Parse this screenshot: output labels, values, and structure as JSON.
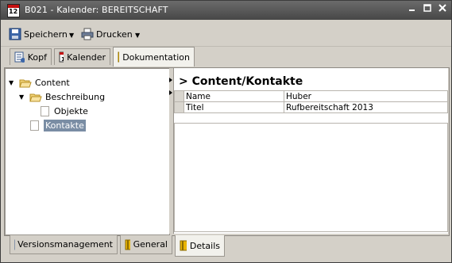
{
  "window": {
    "title": "B021 - Kalender: BEREITSCHAFT",
    "calendar_day": "12"
  },
  "toolbar": {
    "save_label": "Speichern",
    "print_label": "Drucken"
  },
  "tabs": [
    {
      "label": "Kopf",
      "icon": "list-icon"
    },
    {
      "label": "Kalender",
      "icon": "calendar-icon"
    },
    {
      "label": "Dokumentation",
      "icon": "book-icon",
      "active": true
    }
  ],
  "tree": {
    "root": "Content",
    "child": "Beschreibung",
    "grandchild": "Objekte",
    "selected": "Kontakte"
  },
  "detail": {
    "heading": "> Content/Kontakte",
    "rows": [
      {
        "label": "Name",
        "value": "Huber"
      },
      {
        "label": "Titel",
        "value": "Rufbereitschaft 2013"
      }
    ]
  },
  "bottom_tabs": [
    {
      "label": "Versionsmanagement",
      "icon": "ucs-icon"
    },
    {
      "label": "General",
      "icon": "book-icon"
    },
    {
      "label": "Details",
      "icon": "book-icon",
      "active": true
    }
  ],
  "colors": {
    "titlebar": "#474747",
    "selection": "#7a8da4",
    "calendar_red": "#c41010"
  }
}
